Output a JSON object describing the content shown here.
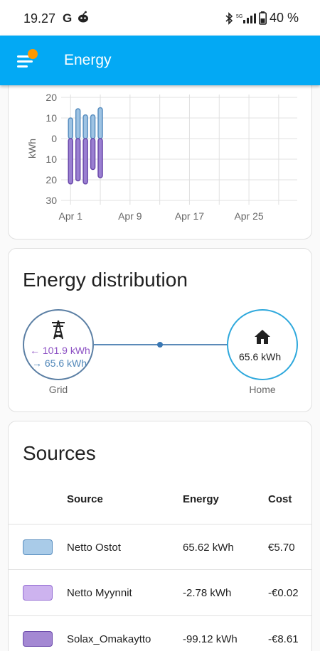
{
  "status_bar": {
    "time": "19.27",
    "g_label": "G",
    "battery": "40 %"
  },
  "app_bar": {
    "title": "Energy"
  },
  "chart_data": {
    "type": "bar",
    "ylabel": "kWh",
    "x_tick_labels": [
      "Apr 1",
      "Apr 9",
      "Apr 17",
      "Apr 25"
    ],
    "y_tick_labels": [
      "20",
      "10",
      "0",
      "10",
      "20",
      "30"
    ],
    "ylim": [
      -30,
      20
    ],
    "grid": true,
    "days": [
      1,
      2,
      3,
      4,
      5
    ],
    "series": [
      {
        "name": "Netto Ostot",
        "color": "#9ec3e3",
        "values": [
          10,
          14.5,
          11.5,
          11.5,
          15
        ]
      },
      {
        "name": "Solax_Omakaytto",
        "color": "#9a7fd1",
        "values": [
          -22,
          -20.5,
          -22,
          -15,
          -19
        ]
      }
    ]
  },
  "distribution": {
    "title": "Energy distribution",
    "grid": {
      "label": "Grid",
      "import_value": "101.9 kWh",
      "export_value": "65.6 kWh",
      "import_arrow": "←",
      "export_arrow": "→"
    },
    "home": {
      "label": "Home",
      "value": "65.6 kWh"
    }
  },
  "sources": {
    "title": "Sources",
    "headers": {
      "source": "Source",
      "energy": "Energy",
      "cost": "Cost"
    },
    "rows": [
      {
        "name": "Netto Ostot",
        "energy": "65.62 kWh",
        "cost": "€5.70",
        "fill": "#a9cbe8",
        "border": "#5a8fc0"
      },
      {
        "name": "Netto Myynnit",
        "energy": "-2.78 kWh",
        "cost": "-€0.02",
        "fill": "#cdb3ef",
        "border": "#9670d4"
      },
      {
        "name": "Solax_Omakaytto",
        "energy": "-99.12 kWh",
        "cost": "-€8.61",
        "fill": "#a488d3",
        "border": "#6b4aab"
      }
    ]
  }
}
